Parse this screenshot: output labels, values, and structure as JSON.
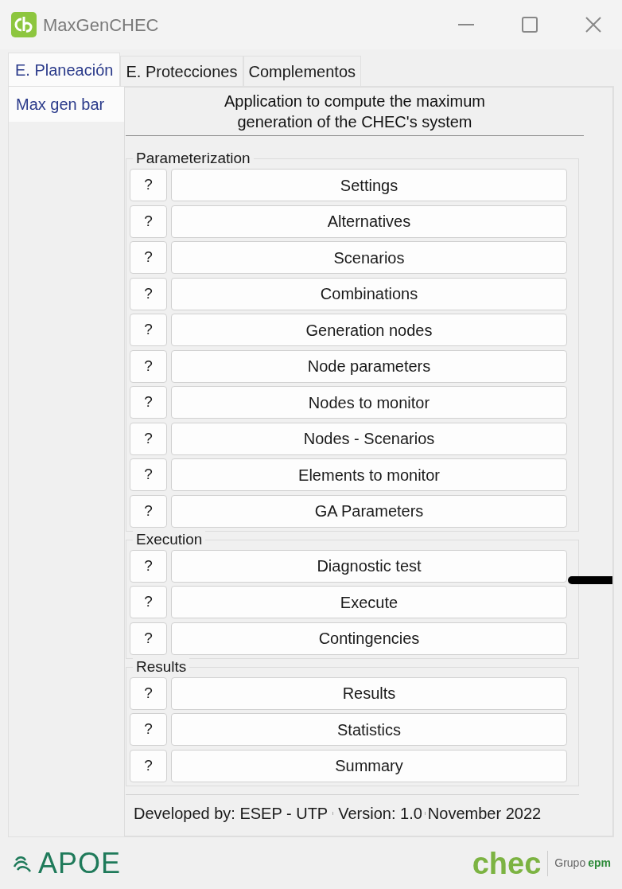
{
  "window": {
    "title": "MaxGenCHEC"
  },
  "tabs": [
    {
      "label": "E. Planeación",
      "selected": true
    },
    {
      "label": "E. Protecciones",
      "selected": false
    },
    {
      "label": "Complementos",
      "selected": false
    }
  ],
  "subtabs": [
    {
      "label": "Max gen bar",
      "selected": true
    }
  ],
  "header": "Application to compute the maximum generation of the CHEC's system",
  "groups": [
    {
      "title": "Parameterization",
      "buttons": [
        {
          "help": "?",
          "label": "Settings"
        },
        {
          "help": "?",
          "label": "Alternatives"
        },
        {
          "help": "?",
          "label": "Scenarios"
        },
        {
          "help": "?",
          "label": "Combinations"
        },
        {
          "help": "?",
          "label": "Generation nodes"
        },
        {
          "help": "?",
          "label": "Node parameters"
        },
        {
          "help": "?",
          "label": "Nodes to monitor"
        },
        {
          "help": "?",
          "label": "Nodes - Scenarios"
        },
        {
          "help": "?",
          "label": "Elements to monitor"
        },
        {
          "help": "?",
          "label": "GA Parameters"
        }
      ]
    },
    {
      "title": "Execution",
      "buttons": [
        {
          "help": "?",
          "label": "Diagnostic test"
        },
        {
          "help": "?",
          "label": "Execute"
        },
        {
          "help": "?",
          "label": "Contingencies"
        }
      ]
    },
    {
      "title": "Results",
      "buttons": [
        {
          "help": "?",
          "label": "Results"
        },
        {
          "help": "?",
          "label": "Statistics"
        },
        {
          "help": "?",
          "label": "Summary"
        }
      ]
    }
  ],
  "footer": [
    "Developed by: ESEP - UTP",
    "Version: 1.0",
    "November 2022"
  ],
  "logos": {
    "left": "APOE",
    "right": "chec",
    "group": "Grupo",
    "group_brand": "epm"
  }
}
